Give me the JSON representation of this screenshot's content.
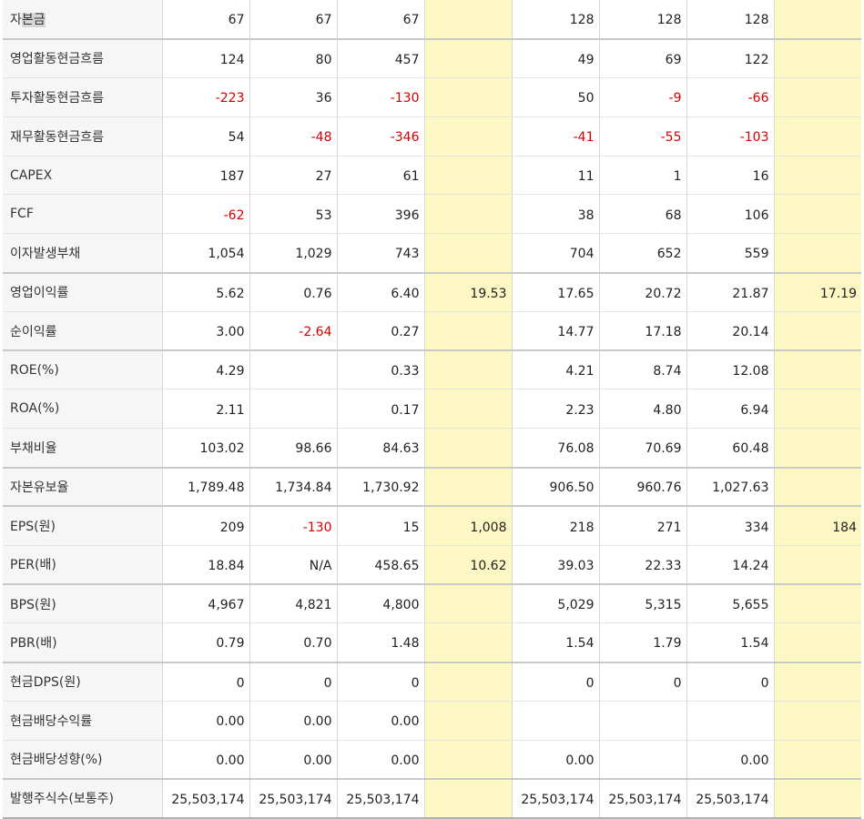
{
  "rows": [
    {
      "label_pre": "자",
      "label_hl": "본금",
      "cells": [
        "67",
        "67",
        "67",
        "",
        "128",
        "128",
        "128",
        ""
      ]
    },
    {
      "label": "영업활동현금흐름",
      "cells": [
        "124",
        "80",
        "457",
        "",
        "49",
        "69",
        "122",
        ""
      ]
    },
    {
      "label": "투자활동현금흐름",
      "cells": [
        "-223",
        "36",
        "-130",
        "",
        "50",
        "-9",
        "-66",
        ""
      ]
    },
    {
      "label": "재무활동현금흐름",
      "cells": [
        "54",
        "-48",
        "-346",
        "",
        "-41",
        "-55",
        "-103",
        ""
      ]
    },
    {
      "label": "CAPEX",
      "cells": [
        "187",
        "27",
        "61",
        "",
        "11",
        "1",
        "16",
        ""
      ]
    },
    {
      "label": "FCF",
      "cells": [
        "-62",
        "53",
        "396",
        "",
        "38",
        "68",
        "106",
        ""
      ]
    },
    {
      "label": "이자발생부채",
      "cells": [
        "1,054",
        "1,029",
        "743",
        "",
        "704",
        "652",
        "559",
        ""
      ]
    },
    {
      "label": "영업이익률",
      "cells": [
        "5.62",
        "0.76",
        "6.40",
        "19.53",
        "17.65",
        "20.72",
        "21.87",
        "17.19"
      ]
    },
    {
      "label": "순이익률",
      "cells": [
        "3.00",
        "-2.64",
        "0.27",
        "",
        "14.77",
        "17.18",
        "20.14",
        ""
      ]
    },
    {
      "label": "ROE(%)",
      "cells": [
        "4.29",
        "",
        "0.33",
        "",
        "4.21",
        "8.74",
        "12.08",
        ""
      ]
    },
    {
      "label": "ROA(%)",
      "cells": [
        "2.11",
        "",
        "0.17",
        "",
        "2.23",
        "4.80",
        "6.94",
        ""
      ]
    },
    {
      "label": "부채비율",
      "cells": [
        "103.02",
        "98.66",
        "84.63",
        "",
        "76.08",
        "70.69",
        "60.48",
        ""
      ]
    },
    {
      "label": "자본유보율",
      "cells": [
        "1,789.48",
        "1,734.84",
        "1,730.92",
        "",
        "906.50",
        "960.76",
        "1,027.63",
        ""
      ]
    },
    {
      "label": "EPS(원)",
      "cells": [
        "209",
        "-130",
        "15",
        "1,008",
        "218",
        "271",
        "334",
        "184"
      ]
    },
    {
      "label": "PER(배)",
      "cells": [
        "18.84",
        "N/A",
        "458.65",
        "10.62",
        "39.03",
        "22.33",
        "14.24",
        ""
      ]
    },
    {
      "label": "BPS(원)",
      "cells": [
        "4,967",
        "4,821",
        "4,800",
        "",
        "5,029",
        "5,315",
        "5,655",
        ""
      ]
    },
    {
      "label": "PBR(배)",
      "cells": [
        "0.79",
        "0.70",
        "1.48",
        "",
        "1.54",
        "1.79",
        "1.54",
        ""
      ]
    },
    {
      "label": "현금DPS(원)",
      "cells": [
        "0",
        "0",
        "0",
        "",
        "0",
        "0",
        "0",
        ""
      ]
    },
    {
      "label": "현금배당수익률",
      "cells": [
        "0.00",
        "0.00",
        "0.00",
        "",
        "",
        "",
        "",
        ""
      ]
    },
    {
      "label": "현금배당성향(%)",
      "cells": [
        "0.00",
        "0.00",
        "0.00",
        "",
        "0.00",
        "",
        "0.00",
        ""
      ]
    },
    {
      "label": "발행주식수(보통주)",
      "cells": [
        "25,503,174",
        "25,503,174",
        "25,503,174",
        "",
        "25,503,174",
        "25,503,174",
        "25,503,174",
        ""
      ]
    }
  ],
  "colors": {
    "negative": "#d40000",
    "estimate_bg": "#fdf7c4",
    "label_bg": "#f6f6f6"
  }
}
